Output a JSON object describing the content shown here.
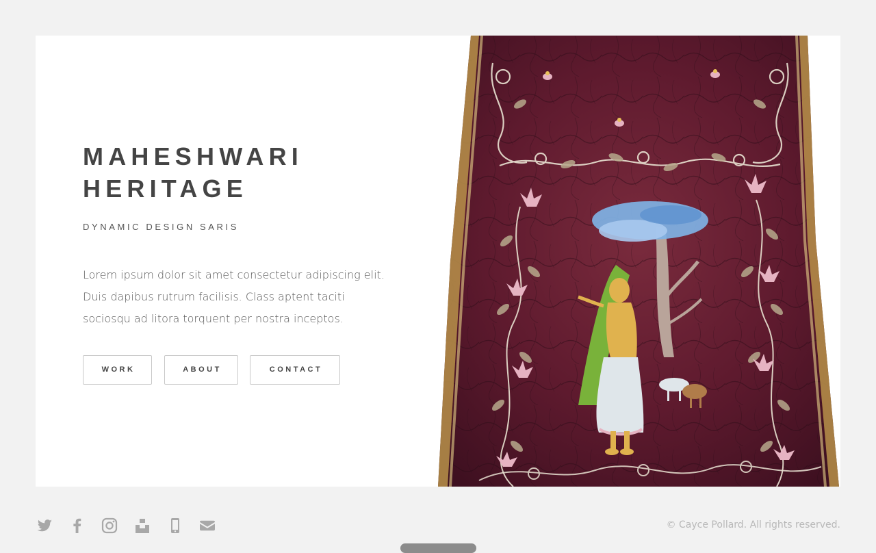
{
  "hero": {
    "title_line1": "MAHESHWARI",
    "title_line2": "HERITAGE",
    "subtitle": "DYNAMIC DESIGN SARIS",
    "intro": "Lorem ipsum dolor sit amet consectetur adipiscing elit. Duis dapibus rutrum facilisis. Class aptent taciti sociosqu ad litora torquent per nostra inceptos."
  },
  "nav": {
    "buttons": [
      {
        "label": "WORK"
      },
      {
        "label": "ABOUT"
      },
      {
        "label": "CONTACT"
      }
    ]
  },
  "image": {
    "alt": "Maroon batik sari with a painted woman beneath a blue-blossom tree and pink floral vine borders"
  },
  "footer": {
    "social_icons": [
      "twitter-icon",
      "facebook-icon",
      "instagram-icon",
      "unsplash-icon",
      "phone-icon",
      "email-icon"
    ],
    "copyright": "© Cayce Pollard. All rights reserved."
  },
  "colors": {
    "page_background": "#f2f2f2",
    "card_background": "#ffffff",
    "title_text": "#444444",
    "body_text": "#5a5a5a",
    "icon_gray": "#a8a8a8",
    "sari_maroon": "#5e1a2e",
    "sari_gold_border": "#b8924a"
  }
}
